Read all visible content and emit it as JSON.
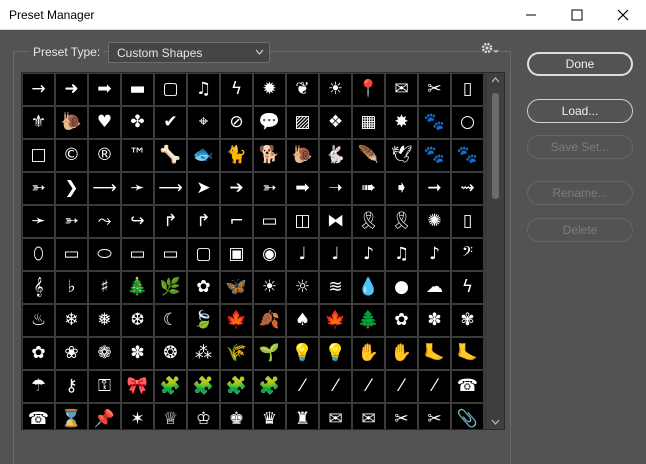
{
  "window": {
    "title": "Preset Manager",
    "controls": [
      "minimize",
      "maximize",
      "close"
    ]
  },
  "preset_type": {
    "label": "Preset Type:",
    "selected": "Custom Shapes"
  },
  "buttons": {
    "done": "Done",
    "load": "Load...",
    "save_set": "Save Set...",
    "rename": "Rename...",
    "delete": "Delete"
  },
  "shapes": [
    "→",
    "➜",
    "➡",
    "▬",
    "▢",
    "♫",
    "ϟ",
    "✹",
    "❦",
    "☀",
    "📍",
    "✉",
    "✂",
    "▯",
    "⚜",
    "🐌",
    "♥",
    "✤",
    "✔",
    "⌖",
    "⊘",
    "💬",
    "▨",
    "❖",
    "▦",
    "✸",
    "🐾",
    "○",
    "□",
    "©",
    "®",
    "™",
    "🦴",
    "🐟",
    "🐈",
    "🐕",
    "🐌",
    "🐇",
    "🪶",
    "🕊",
    "🐾",
    "🐾",
    "➳",
    "❯",
    "⟶",
    "➛",
    "⟶",
    "➤",
    "➔",
    "➳",
    "➡",
    "➝",
    "➠",
    "➧",
    "➞",
    "⇝",
    "➛",
    "➳",
    "⤳",
    "↪",
    "↱",
    "↱",
    "⌐",
    "▭",
    "◫",
    "⧓",
    "🎗",
    "🎗",
    "✺",
    "▯",
    "⬯",
    "▭",
    "⬭",
    "▭",
    "▭",
    "▢",
    "▣",
    "◉",
    "♩",
    "♩",
    "♪",
    "♫",
    "♪",
    "𝄢",
    "𝄞",
    "♭",
    "♯",
    "🎄",
    "🌿",
    "✿",
    "🦋",
    "☀",
    "☼",
    "≋",
    "💧",
    "●",
    "☁",
    "ϟ",
    "♨",
    "❄",
    "❅",
    "❆",
    "☾",
    "🍃",
    "🍁",
    "🍂",
    "♠",
    "🍁",
    "🌲",
    "✿",
    "✽",
    "✾",
    "✿",
    "❀",
    "❁",
    "✽",
    "❂",
    "⁂",
    "🌾",
    "🌱",
    "💡",
    "💡",
    "✋",
    "✋",
    "🦶",
    "🦶",
    "☂",
    "⚷",
    "⚿",
    "🎀",
    "🧩",
    "🧩",
    "🧩",
    "🧩",
    "⁄",
    "⁄",
    "⁄",
    "⁄",
    "⁄",
    "☎",
    "☎",
    "⌛",
    "📌",
    "✶",
    "♕",
    "♔",
    "♚",
    "♛",
    "♜",
    "✉",
    "✉",
    "✂",
    "✂",
    "📎"
  ]
}
